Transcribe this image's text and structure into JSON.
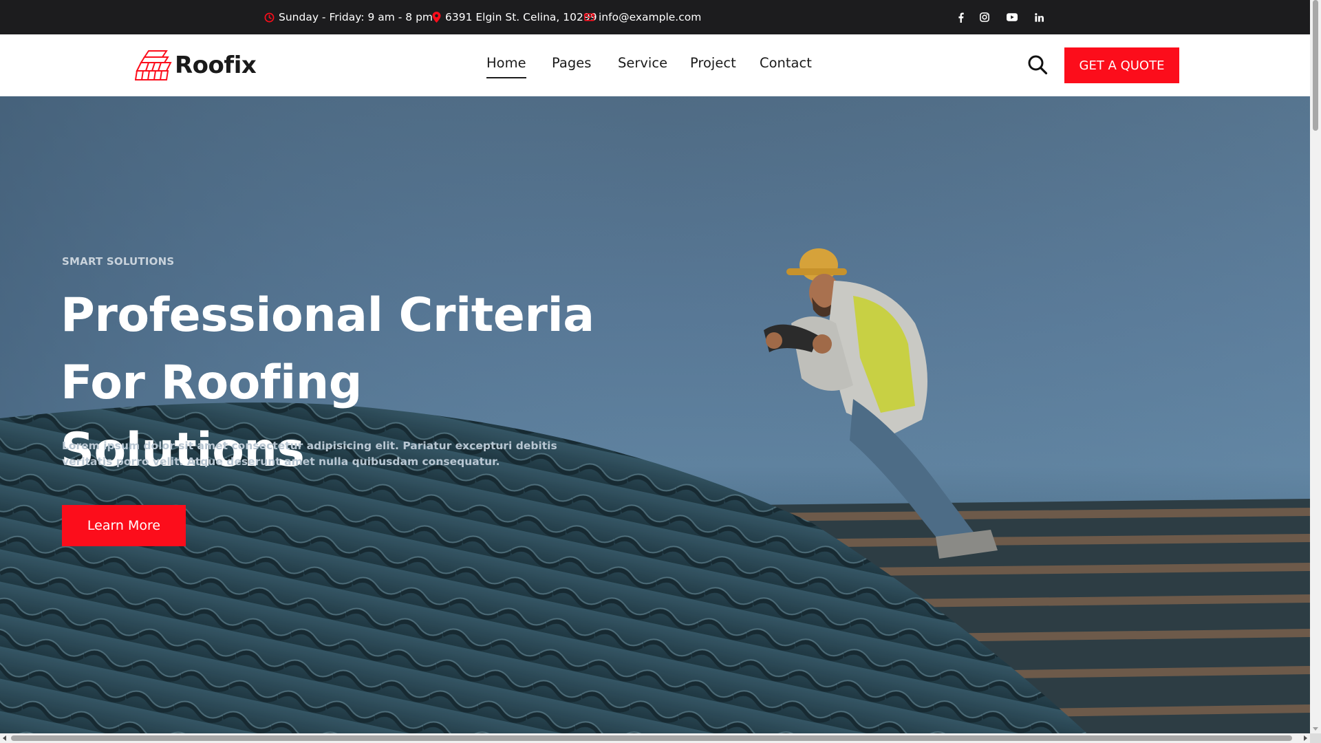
{
  "topbar": {
    "hours": "Sunday - Friday: 9 am - 8 pm",
    "address": "6391 Elgin St. Celina, 10299",
    "email": "info@example.com",
    "icons": {
      "hours": "clock-icon",
      "address": "location-pin-icon",
      "email": "envelope-icon"
    },
    "social": [
      "facebook-icon",
      "instagram-icon",
      "youtube-icon",
      "linkedin-icon"
    ]
  },
  "header": {
    "logo_text": "Roofix",
    "nav": [
      {
        "label": "Home",
        "active": true
      },
      {
        "label": "Pages",
        "active": false
      },
      {
        "label": "Service",
        "active": false
      },
      {
        "label": "Project",
        "active": false
      },
      {
        "label": "Contact",
        "active": false
      }
    ],
    "search_icon": "search-icon",
    "cta_label": "GET A QUOTE"
  },
  "hero": {
    "eyebrow": "SMART SOLUTIONS",
    "title_line1": "Professional Criteria",
    "title_line2": "For Roofing Solutions",
    "description": "Lorem ipsum dolor sit amet consectetur adipisicing elit. Pariatur excepturi debitis veritatis porro velit. Atque deserunt amet nulla quibusdam consequatur.",
    "button_label": "Learn More"
  },
  "colors": {
    "accent": "#fc0d1b",
    "topbar_bg": "#1c1c1e",
    "hero_overlay": "#587896"
  }
}
